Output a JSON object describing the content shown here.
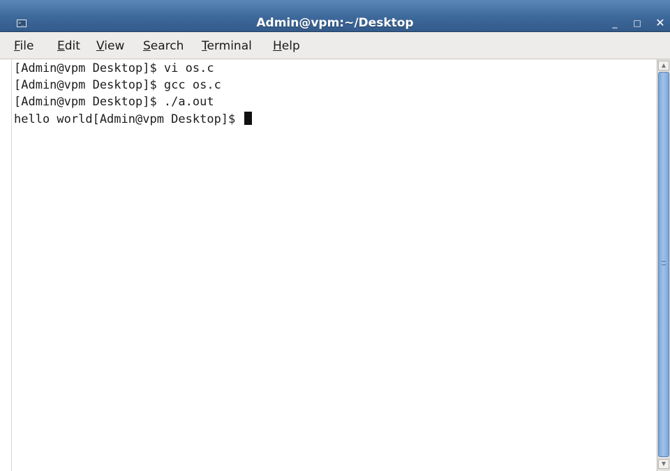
{
  "window": {
    "title": "Admin@vpm:~/Desktop",
    "controls": {
      "minimize": "_",
      "maximize": "□",
      "close": "✕"
    },
    "icon": "terminal-icon"
  },
  "menubar": {
    "items": [
      {
        "mnemonic": "F",
        "rest": "ile"
      },
      {
        "mnemonic": "E",
        "rest": "dit"
      },
      {
        "mnemonic": "V",
        "rest": "iew"
      },
      {
        "mnemonic": "S",
        "rest": "earch"
      },
      {
        "mnemonic": "T",
        "rest": "erminal"
      },
      {
        "mnemonic": "H",
        "rest": "elp"
      }
    ]
  },
  "terminal": {
    "lines": [
      "[Admin@vpm Desktop]$ vi os.c",
      "[Admin@vpm Desktop]$ gcc os.c",
      "[Admin@vpm Desktop]$ ./a.out",
      "hello world[Admin@vpm Desktop]$ "
    ]
  },
  "colors": {
    "titlebar": "#3f6a9c",
    "scroll_thumb": "#8fb4e0"
  }
}
